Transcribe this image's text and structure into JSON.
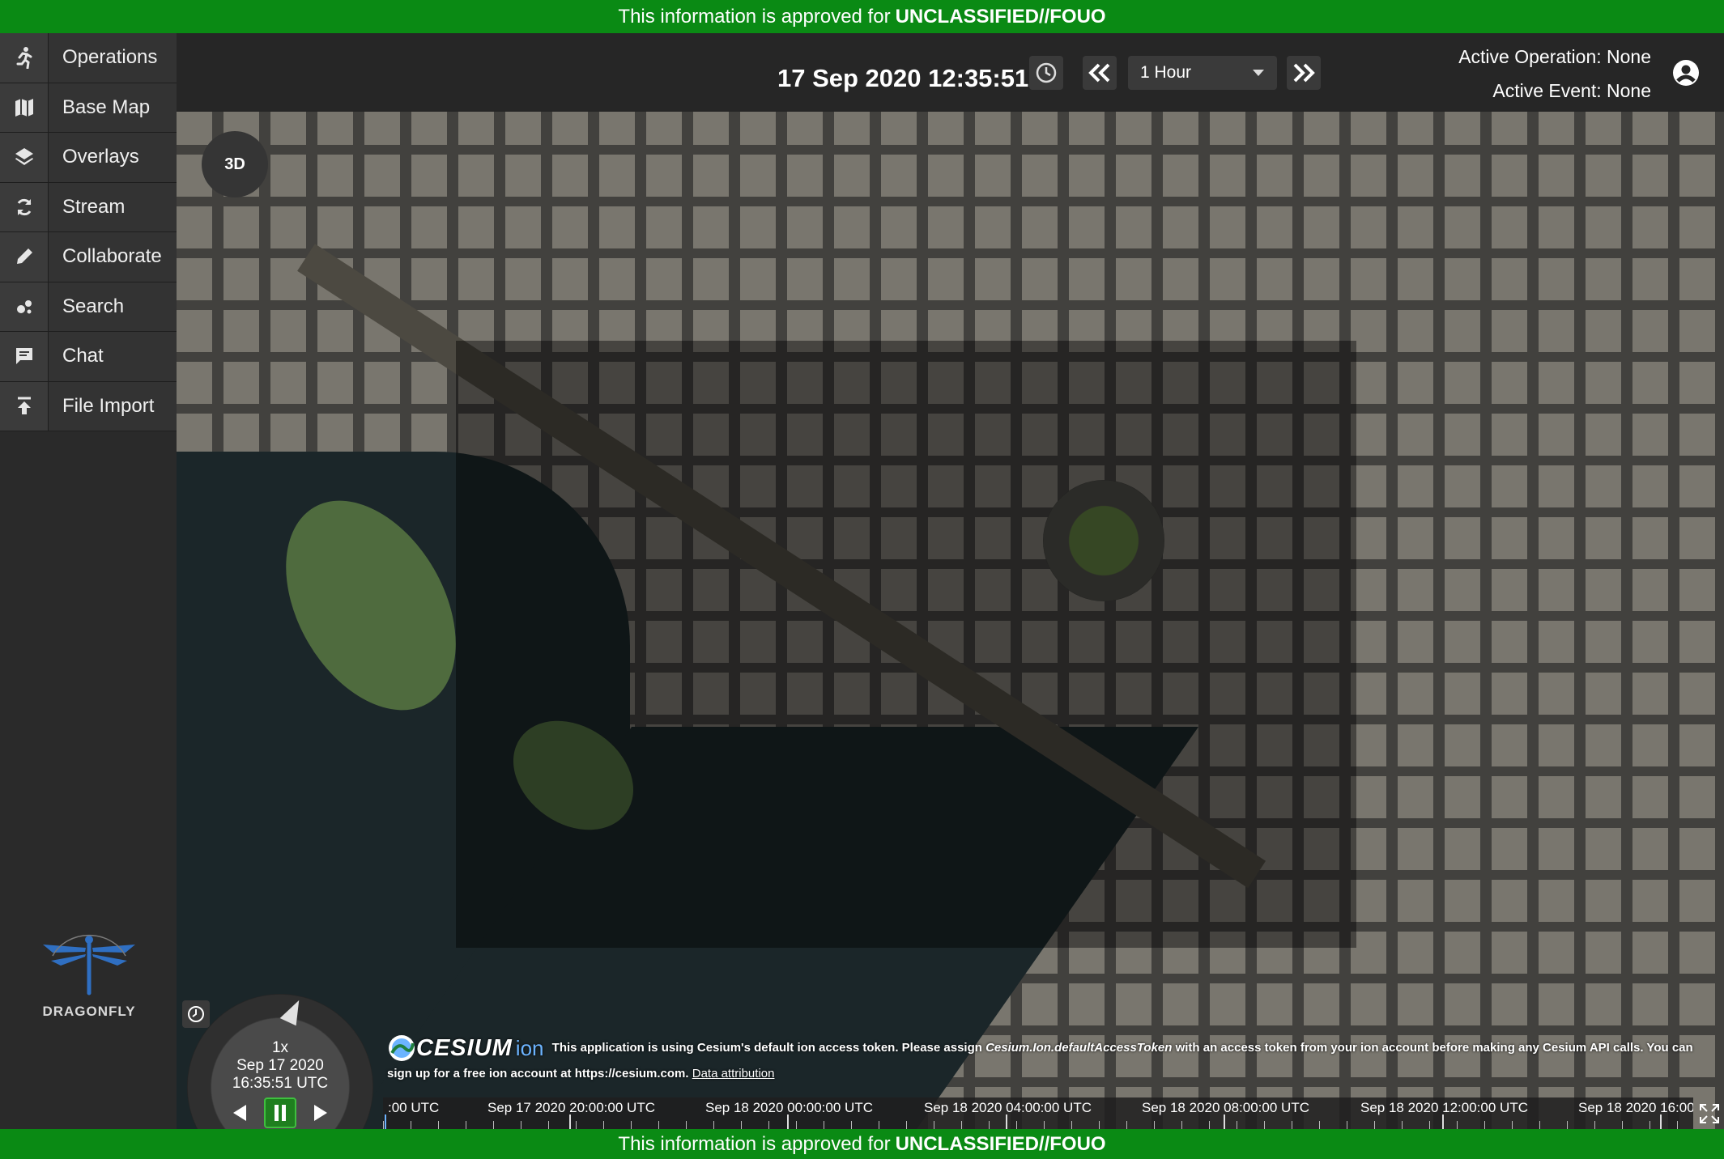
{
  "banner": {
    "prefix": "This information is approved for",
    "level": "UNCLASSIFIED//FOUO"
  },
  "sidebar": {
    "items": [
      {
        "label": "Operations",
        "icon": "running-person-icon"
      },
      {
        "label": "Base Map",
        "icon": "map-icon"
      },
      {
        "label": "Overlays",
        "icon": "layers-icon"
      },
      {
        "label": "Stream",
        "icon": "sync-icon"
      },
      {
        "label": "Collaborate",
        "icon": "pencil-icon"
      },
      {
        "label": "Search",
        "icon": "bubbles-icon"
      },
      {
        "label": "Chat",
        "icon": "chat-icon"
      },
      {
        "label": "File Import",
        "icon": "upload-icon"
      }
    ],
    "logo_text": "DRAGONFLY"
  },
  "header": {
    "datetime": "17 Sep 2020 12:35:51",
    "time_range": "1 Hour",
    "active_operation": "Active Operation: None",
    "active_event": "Active Event: None"
  },
  "map": {
    "mode_button": "3D"
  },
  "animation": {
    "speed": "1x",
    "date": "Sep 17 2020",
    "time": "16:35:51 UTC"
  },
  "credit": {
    "logo_word": "CESIUM",
    "logo_suffix": "ion",
    "message_part1": "This application is using Cesium's default ion access token. Please assign",
    "token_name": "Cesium.Ion.defaultAccessToken",
    "message_part2": "with an access token from your ion account before making any Cesium API calls. You can",
    "message_part3": "sign up for a free ion account at https://cesium.com.",
    "attribution_link": "Data attribution"
  },
  "timeline": {
    "labels": [
      ":00 UTC",
      "Sep 17 2020 20:00:00 UTC",
      "Sep 18 2020 00:00:00 UTC",
      "Sep 18 2020 04:00:00 UTC",
      "Sep 18 2020 08:00:00 UTC",
      "Sep 18 2020 12:00:00 UTC",
      "Sep 18 2020 16:00"
    ]
  },
  "colors": {
    "banner_green": "#0a8a14",
    "sidebar_bg": "#2a2a2a",
    "header_bg": "#262626",
    "cesium_ion_blue": "#6cb4ff"
  }
}
